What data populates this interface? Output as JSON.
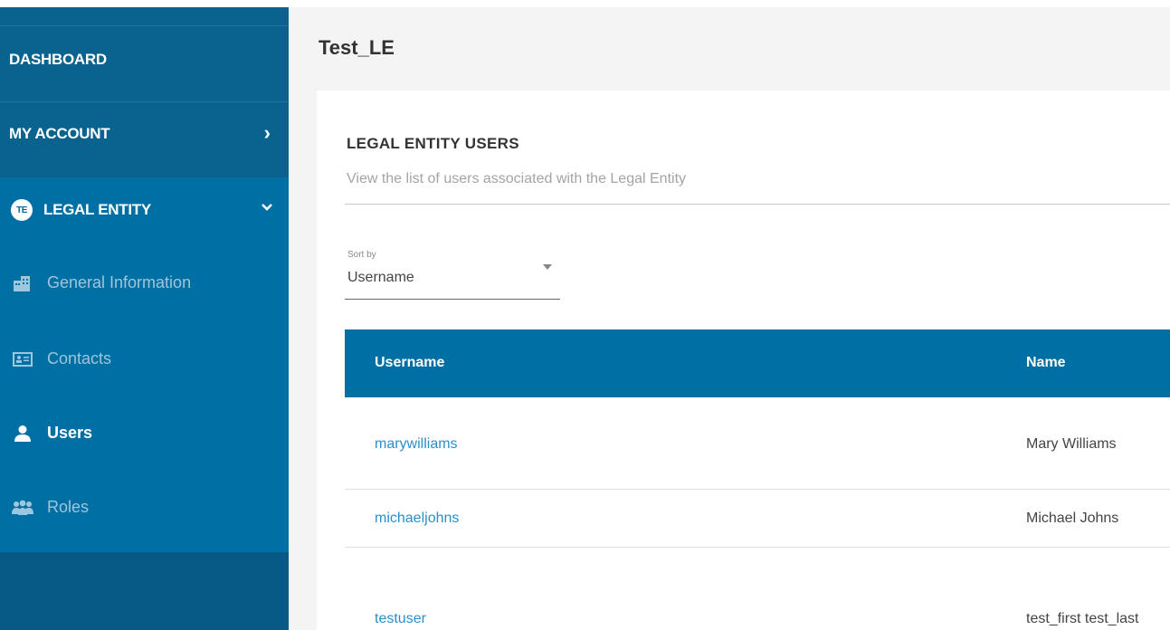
{
  "sidebar": {
    "dashboard": "DASHBOARD",
    "my_account": "MY ACCOUNT",
    "legal_entity": "LEGAL ENTITY",
    "legal_entity_badge": "TE",
    "chevron_right": "›",
    "chevron_down": "⌄",
    "items": [
      {
        "label": "General Information",
        "icon": "building-icon"
      },
      {
        "label": "Contacts",
        "icon": "contact-card-icon"
      },
      {
        "label": "Users",
        "icon": "user-icon"
      },
      {
        "label": "Roles",
        "icon": "group-icon"
      }
    ],
    "active_item": "Users"
  },
  "main": {
    "title": "Test_LE",
    "card": {
      "title": "LEGAL ENTITY USERS",
      "subtitle": "View the list of users associated with the Legal Entity",
      "sort": {
        "label": "Sort by",
        "value": "Username"
      },
      "table": {
        "columns": [
          "Username",
          "Name"
        ],
        "rows": [
          {
            "username": "marywilliams",
            "name": "Mary Williams"
          },
          {
            "username": "michaeljohns",
            "name": "Michael Johns"
          },
          {
            "username": "testuser",
            "name": "test_first test_last"
          }
        ]
      }
    }
  },
  "colors": {
    "sidebar": "#006fa3",
    "sidebar_dark": "#0a628f",
    "table_header": "#006fa3",
    "link": "#2b8fc9"
  }
}
